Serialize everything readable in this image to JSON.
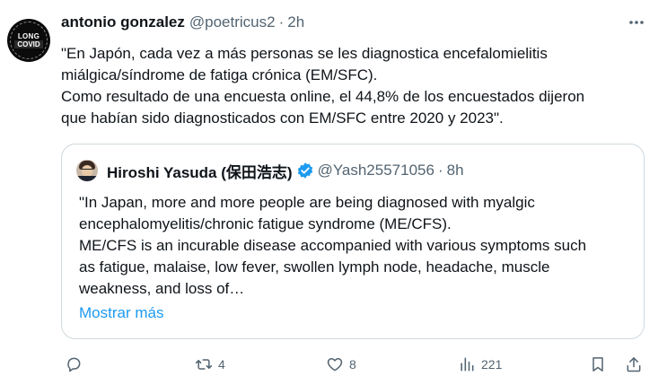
{
  "author": {
    "name": "antonio gonzalez",
    "handle": "@poetricus2",
    "separator": "·",
    "time": "2h",
    "avatar_text_top": "LONG",
    "avatar_text_bottom": "COVID"
  },
  "tweet_text": [
    "\"En Japón, cada vez a más personas se les diagnostica encefalomielitis",
    "miálgica/síndrome de fatiga crónica (EM/SFC).",
    "Como resultado de una encuesta online, el 44,8% de los encuestados dijeron",
    "que habían sido diagnosticados con EM/SFC entre 2020 y 2023\"."
  ],
  "quoted": {
    "name": "Hiroshi Yasuda (保田浩志)",
    "handle": "@Yash25571056",
    "separator": "·",
    "time": "8h",
    "text": [
      "\"In Japan, more and more people are being diagnosed with myalgic",
      "encephalomyelitis/chronic fatigue syndrome (ME/CFS).",
      "ME/CFS is an incurable disease accompanied with various symptoms such",
      "as fatigue, malaise, low fever, swollen lymph node, headache, muscle",
      "weakness, and loss of…"
    ],
    "show_more": "Mostrar más"
  },
  "actions": {
    "reply_count": "",
    "retweet_count": "4",
    "like_count": "8",
    "views_count": "221"
  },
  "colors": {
    "text": "#0f1419",
    "muted": "#536471",
    "link": "#1d9bf0",
    "border": "#cfd9de",
    "verified": "#1d9bf0"
  },
  "icons": {
    "more": "more-dots-icon",
    "verified": "verified-badge-icon",
    "reply": "reply-icon",
    "retweet": "retweet-icon",
    "like": "heart-icon",
    "views": "views-chart-icon",
    "bookmark": "bookmark-icon",
    "share": "share-icon"
  }
}
